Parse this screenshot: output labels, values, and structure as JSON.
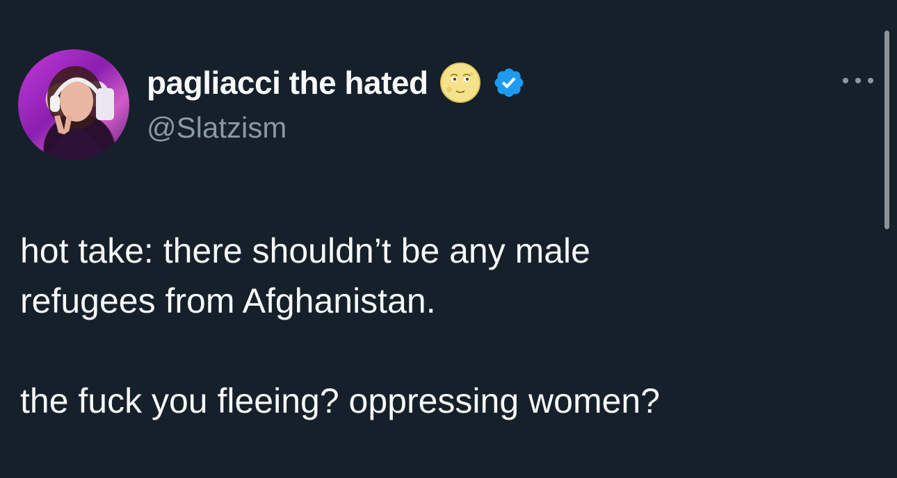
{
  "tweet": {
    "author": {
      "display_name": "pagliacci the hated",
      "name_emoji": "🌝",
      "handle": "@Slatzism",
      "verified": true,
      "verified_color": "#1d9bf0",
      "avatar_icon": "profile-avatar"
    },
    "more_icon": "more-options-icon",
    "text": {
      "line1": "hot take: there shouldn’t be any male",
      "line2": "refugees from Afghanistan.",
      "line3": "the fuck you fleeing? oppressing women?"
    }
  },
  "theme": {
    "background": "#15202b",
    "text": "#f7f9f9",
    "secondary_text": "#8b98a5"
  }
}
